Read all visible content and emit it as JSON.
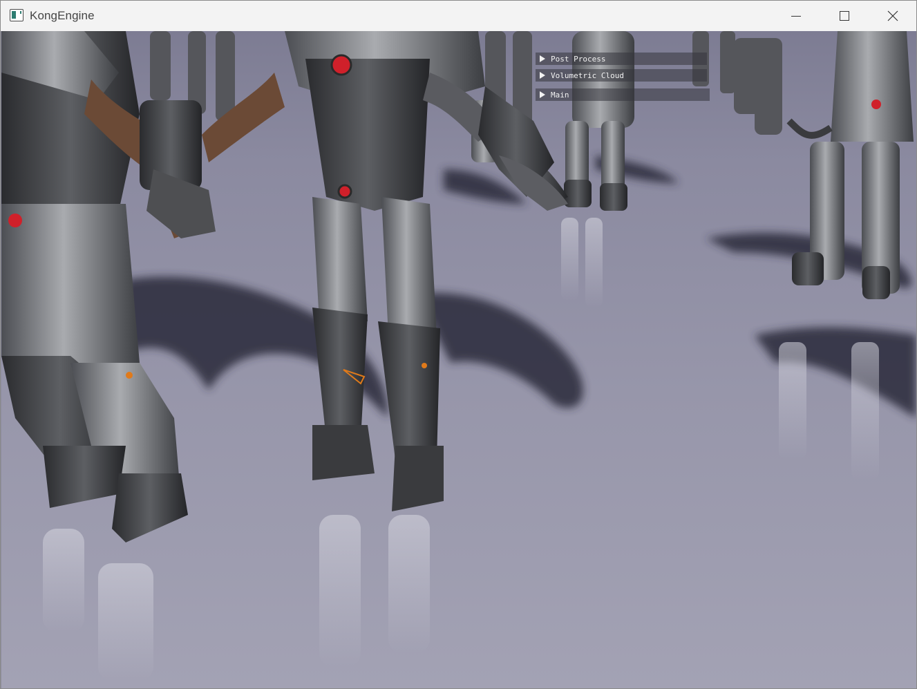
{
  "window": {
    "title": "KongEngine",
    "controls": {
      "minimize": "minimize-icon",
      "maximize": "maximize-icon",
      "close": "close-icon"
    }
  },
  "debug_panels": [
    {
      "label": "Post Process",
      "icon": "triangle-right-icon"
    },
    {
      "label": "Volumetric Cloud",
      "icon": "triangle-right-icon"
    },
    {
      "label": "Main",
      "icon": "triangle-right-icon"
    }
  ],
  "colors": {
    "floor": "#9796aa",
    "armor": "#6e7075",
    "accent_red": "#d0202a",
    "titlebar": "#f3f3f3"
  }
}
